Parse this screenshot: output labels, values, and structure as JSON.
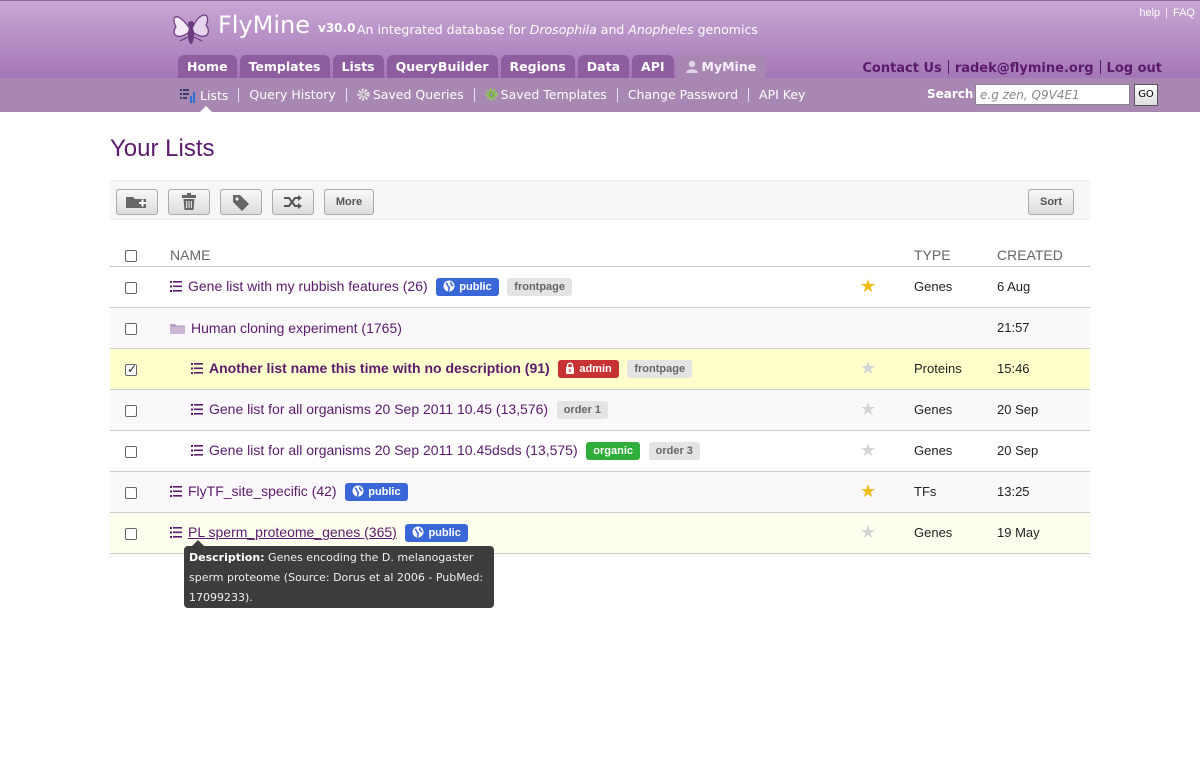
{
  "brand": {
    "name": "FlyMine",
    "version": "v30.0",
    "tagline_pre": "An integrated database for ",
    "tagline_em1": "Drosophila",
    "tagline_mid": " and ",
    "tagline_em2": "Anopheles",
    "tagline_post": " genomics"
  },
  "top_links": {
    "help": "help",
    "faq": "FAQ"
  },
  "main_nav": [
    {
      "label": "Home"
    },
    {
      "label": "Templates"
    },
    {
      "label": "Lists"
    },
    {
      "label": "QueryBuilder"
    },
    {
      "label": "Regions"
    },
    {
      "label": "Data"
    },
    {
      "label": "API"
    },
    {
      "label": "MyMine"
    }
  ],
  "user_links": {
    "contact": "Contact Us",
    "email": "radek@flymine.org",
    "logout": "Log out"
  },
  "sub_nav": [
    {
      "label": "Lists"
    },
    {
      "label": "Query History"
    },
    {
      "label": "Saved Queries"
    },
    {
      "label": "Saved Templates"
    },
    {
      "label": "Change Password"
    },
    {
      "label": "API Key"
    }
  ],
  "search": {
    "label": "Search:",
    "placeholder": "e.g zen, Q9V4E1",
    "go": "GO"
  },
  "page_title": "Your Lists",
  "toolbar": {
    "more": "More",
    "sort": "Sort"
  },
  "columns": {
    "name": "NAME",
    "type": "TYPE",
    "created": "CREATED"
  },
  "rows": [
    {
      "name": "Gene list with my rubbish features (26)",
      "tags": [
        "public",
        "frontpage"
      ],
      "type": "Genes",
      "created": "6 Aug"
    },
    {
      "name": "Human cloning experiment (1765)",
      "tags": [],
      "type": "",
      "created": "21:57"
    },
    {
      "name": "Another list name this time with no description (91)",
      "tags": [
        "admin",
        "frontpage"
      ],
      "type": "Proteins",
      "created": "15:46"
    },
    {
      "name": "Gene list for all organisms 20 Sep 2011 10.45 (13,576)",
      "tags": [
        "order 1"
      ],
      "type": "Genes",
      "created": "20 Sep"
    },
    {
      "name": "Gene list for all organisms 20 Sep 2011 10.45dsds (13,575)",
      "tags": [
        "organic",
        "order 3"
      ],
      "type": "Genes",
      "created": "20 Sep"
    },
    {
      "name": "FlyTF_site_specific (42)",
      "tags": [
        "public"
      ],
      "type": "TFs",
      "created": "13:25"
    },
    {
      "name": "PL sperm_proteome_genes (365)",
      "tags": [
        "public"
      ],
      "type": "Genes",
      "created": "19 May"
    }
  ],
  "tooltip": {
    "label": "Description:",
    "text": " Genes encoding the D. melanogaster sperm proteome (Source: Dorus et al 2006 - PubMed: 17099233)."
  },
  "colors": {
    "header_purple": "#a477b6",
    "link_purple": "#5b1a6b",
    "public_tag": "#3a67d8",
    "admin_tag": "#c73232",
    "organic_tag": "#2fae3b",
    "star": "#f2bb17"
  },
  "icons": {
    "logo": "flymine-fly-logo",
    "sub_nav_lists": "list-chart-icon",
    "gear": "gear-icon",
    "toolbar": [
      "new-folder-icon",
      "trash-icon",
      "tag-icon",
      "shuffle-icon"
    ],
    "list": "list-icon",
    "folder": "folder-icon",
    "star": "star-icon"
  }
}
